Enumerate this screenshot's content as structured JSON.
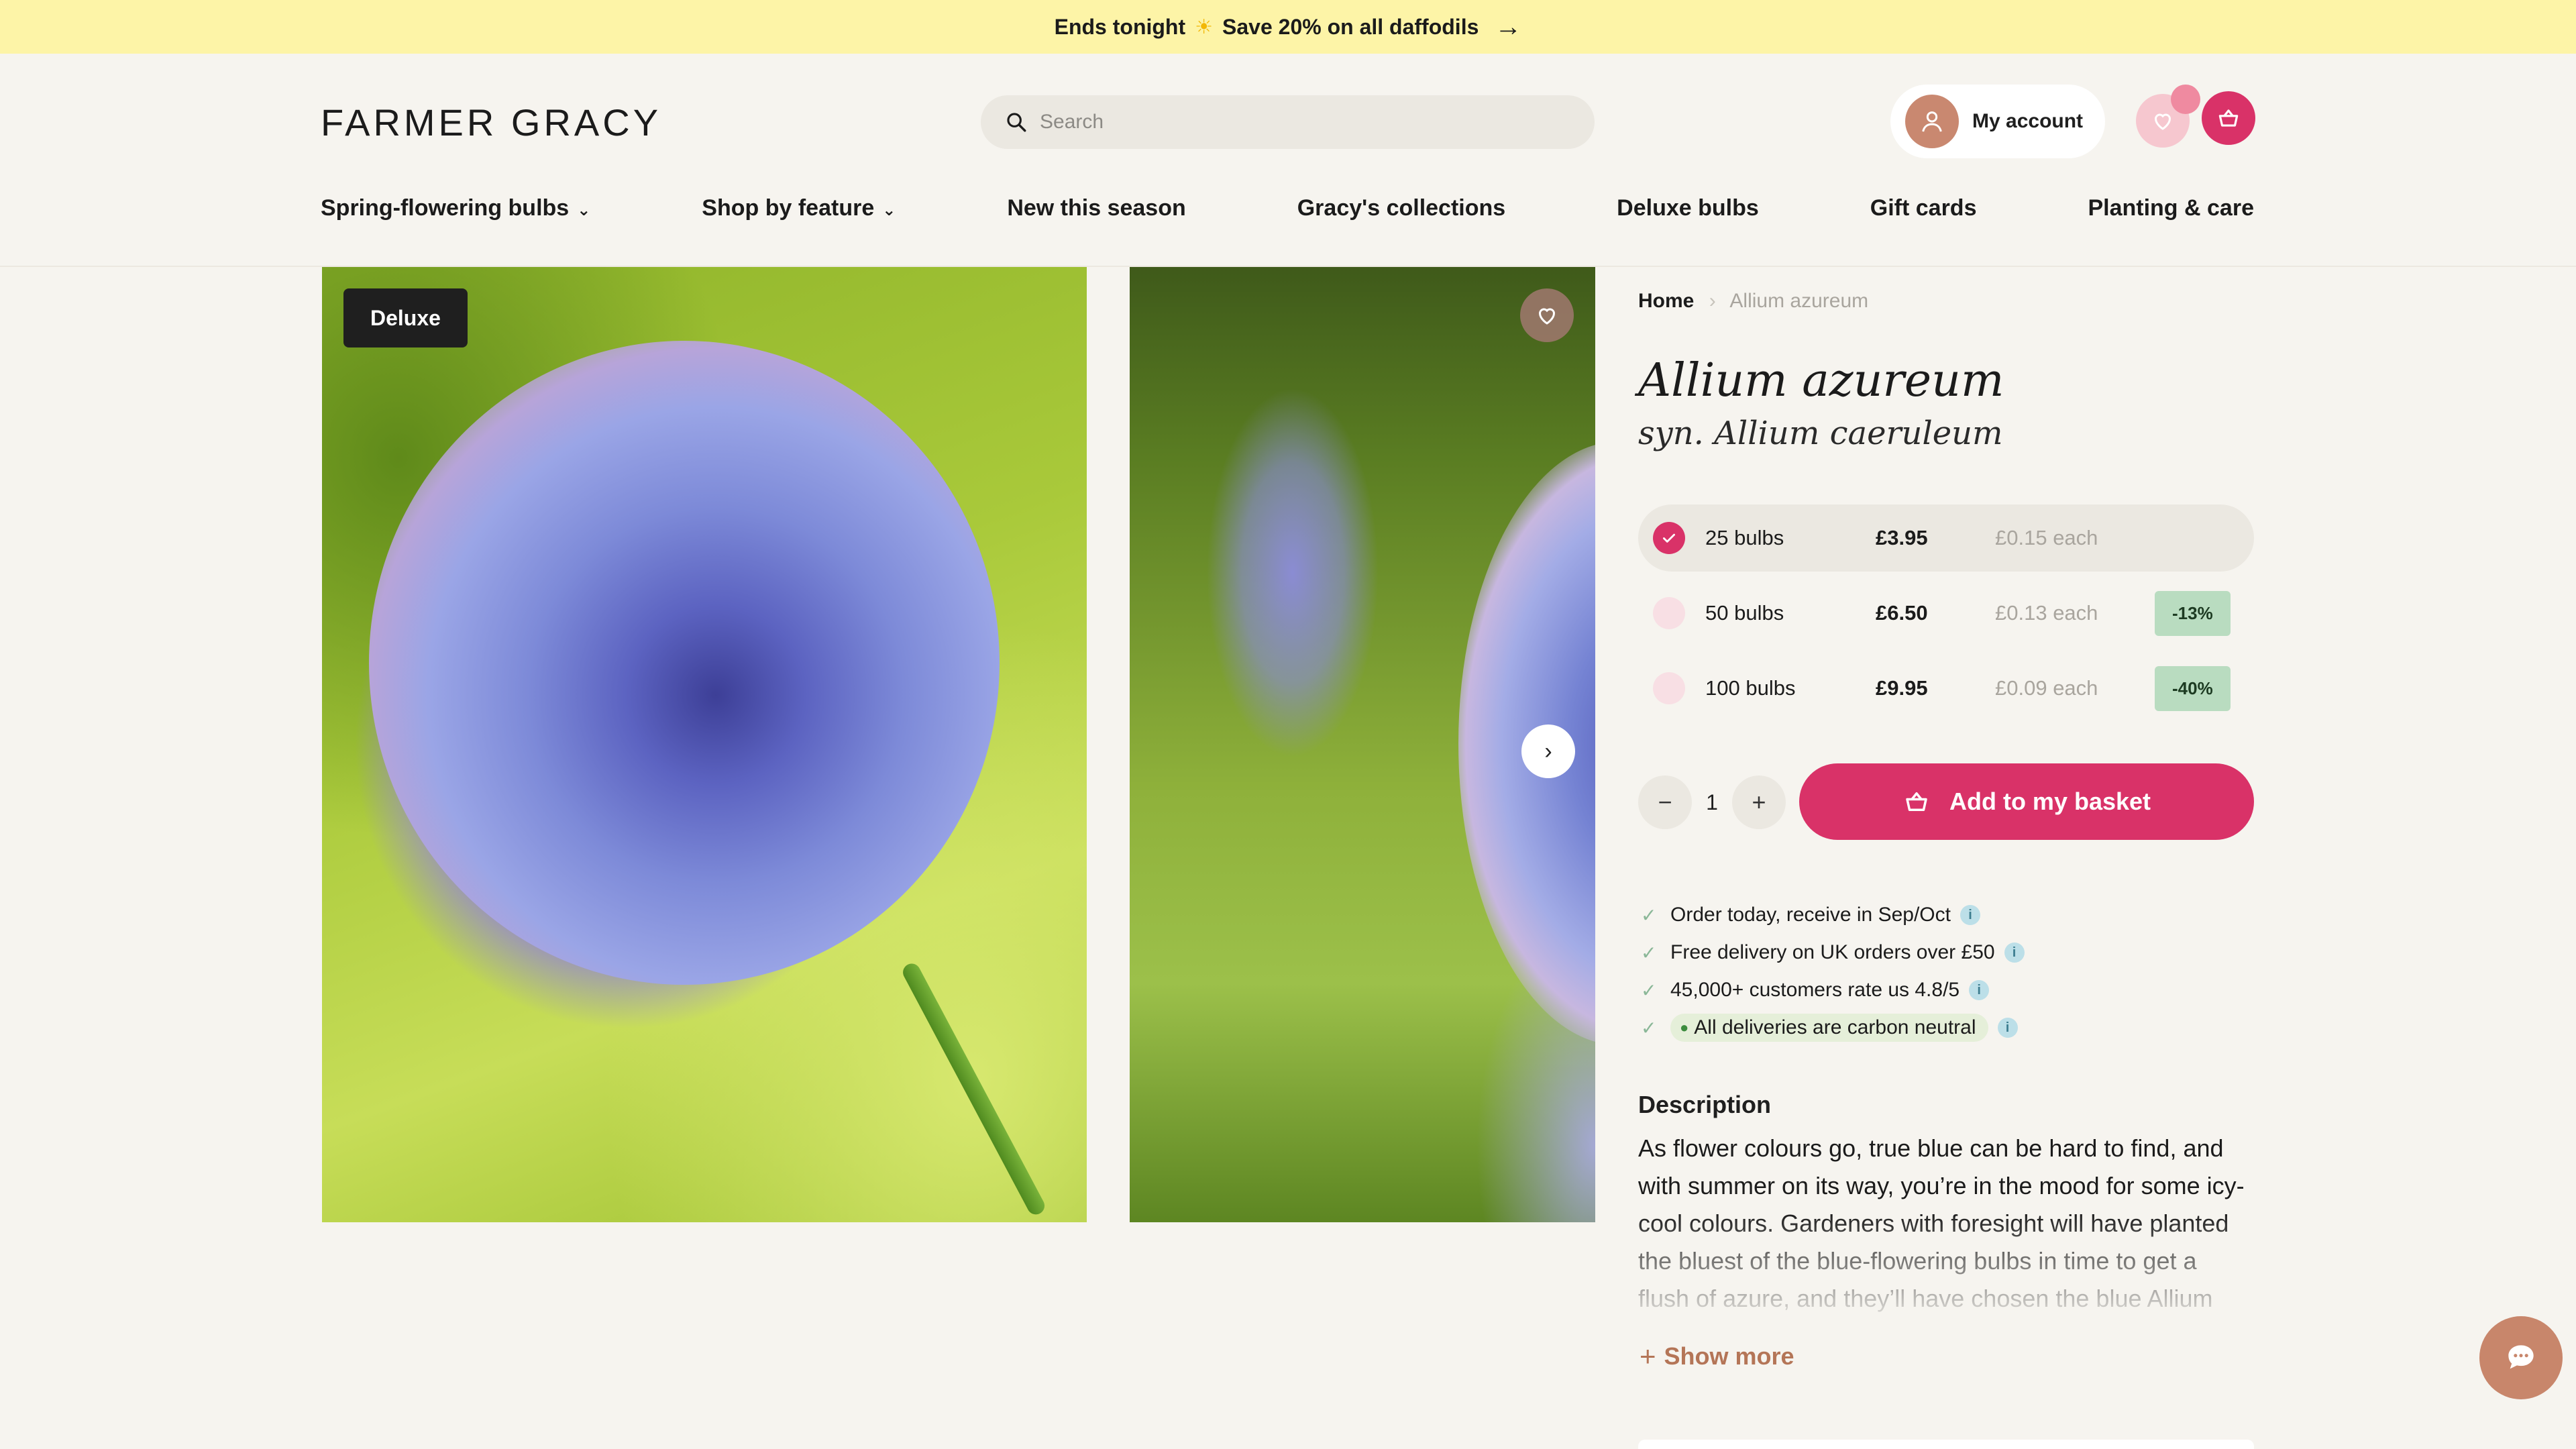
{
  "announcement": {
    "text_before": "Ends tonight",
    "icon": "sun-icon",
    "text_after": "Save 20% on all daffodils"
  },
  "header": {
    "logo": "FARMER GRACY",
    "search_placeholder": "Search",
    "account_label": "My account"
  },
  "nav": [
    {
      "label": "Spring-flowering bulbs",
      "has_dropdown": true
    },
    {
      "label": "Shop by feature",
      "has_dropdown": true
    },
    {
      "label": "New this season",
      "has_dropdown": false
    },
    {
      "label": "Gracy's collections",
      "has_dropdown": false
    },
    {
      "label": "Deluxe bulbs",
      "has_dropdown": false
    },
    {
      "label": "Gift cards",
      "has_dropdown": false
    },
    {
      "label": "Planting & care",
      "has_dropdown": false
    }
  ],
  "gallery": {
    "badge": "Deluxe"
  },
  "breadcrumb": {
    "home": "Home",
    "current": "Allium azureum"
  },
  "product": {
    "title": "Allium azureum",
    "synonym": "syn. Allium caeruleum",
    "options": [
      {
        "qty": "25 bulbs",
        "price": "£3.95",
        "each": "£0.15 each",
        "discount": "",
        "selected": true
      },
      {
        "qty": "50 bulbs",
        "price": "£6.50",
        "each": "£0.13 each",
        "discount": "-13%",
        "selected": false
      },
      {
        "qty": "100 bulbs",
        "price": "£9.95",
        "each": "£0.09 each",
        "discount": "-40%",
        "selected": false
      }
    ],
    "quantity": "1",
    "add_button": "Add to my basket"
  },
  "perks": [
    "Order today, receive in Sep/Oct",
    "Free delivery on UK orders over £50",
    "45,000+ customers rate us 4.8/5",
    "All deliveries are carbon neutral"
  ],
  "description": {
    "heading": "Description",
    "text": "As flower colours go, true blue can be hard to find, and with summer on its way, you’re in the mood for some icy-cool colours. Gardeners with foresight will have planted the bluest of the blue-flowering bulbs in time to get a flush of azure, and they’ll have chosen the blue Allium",
    "show_more": "Show more"
  },
  "colors": {
    "accent": "#d93268",
    "announcement_bg": "#fdf4a7",
    "page_bg": "#f6f4ef",
    "discount_bg": "#b9dcc0",
    "show_more": "#b47557"
  }
}
